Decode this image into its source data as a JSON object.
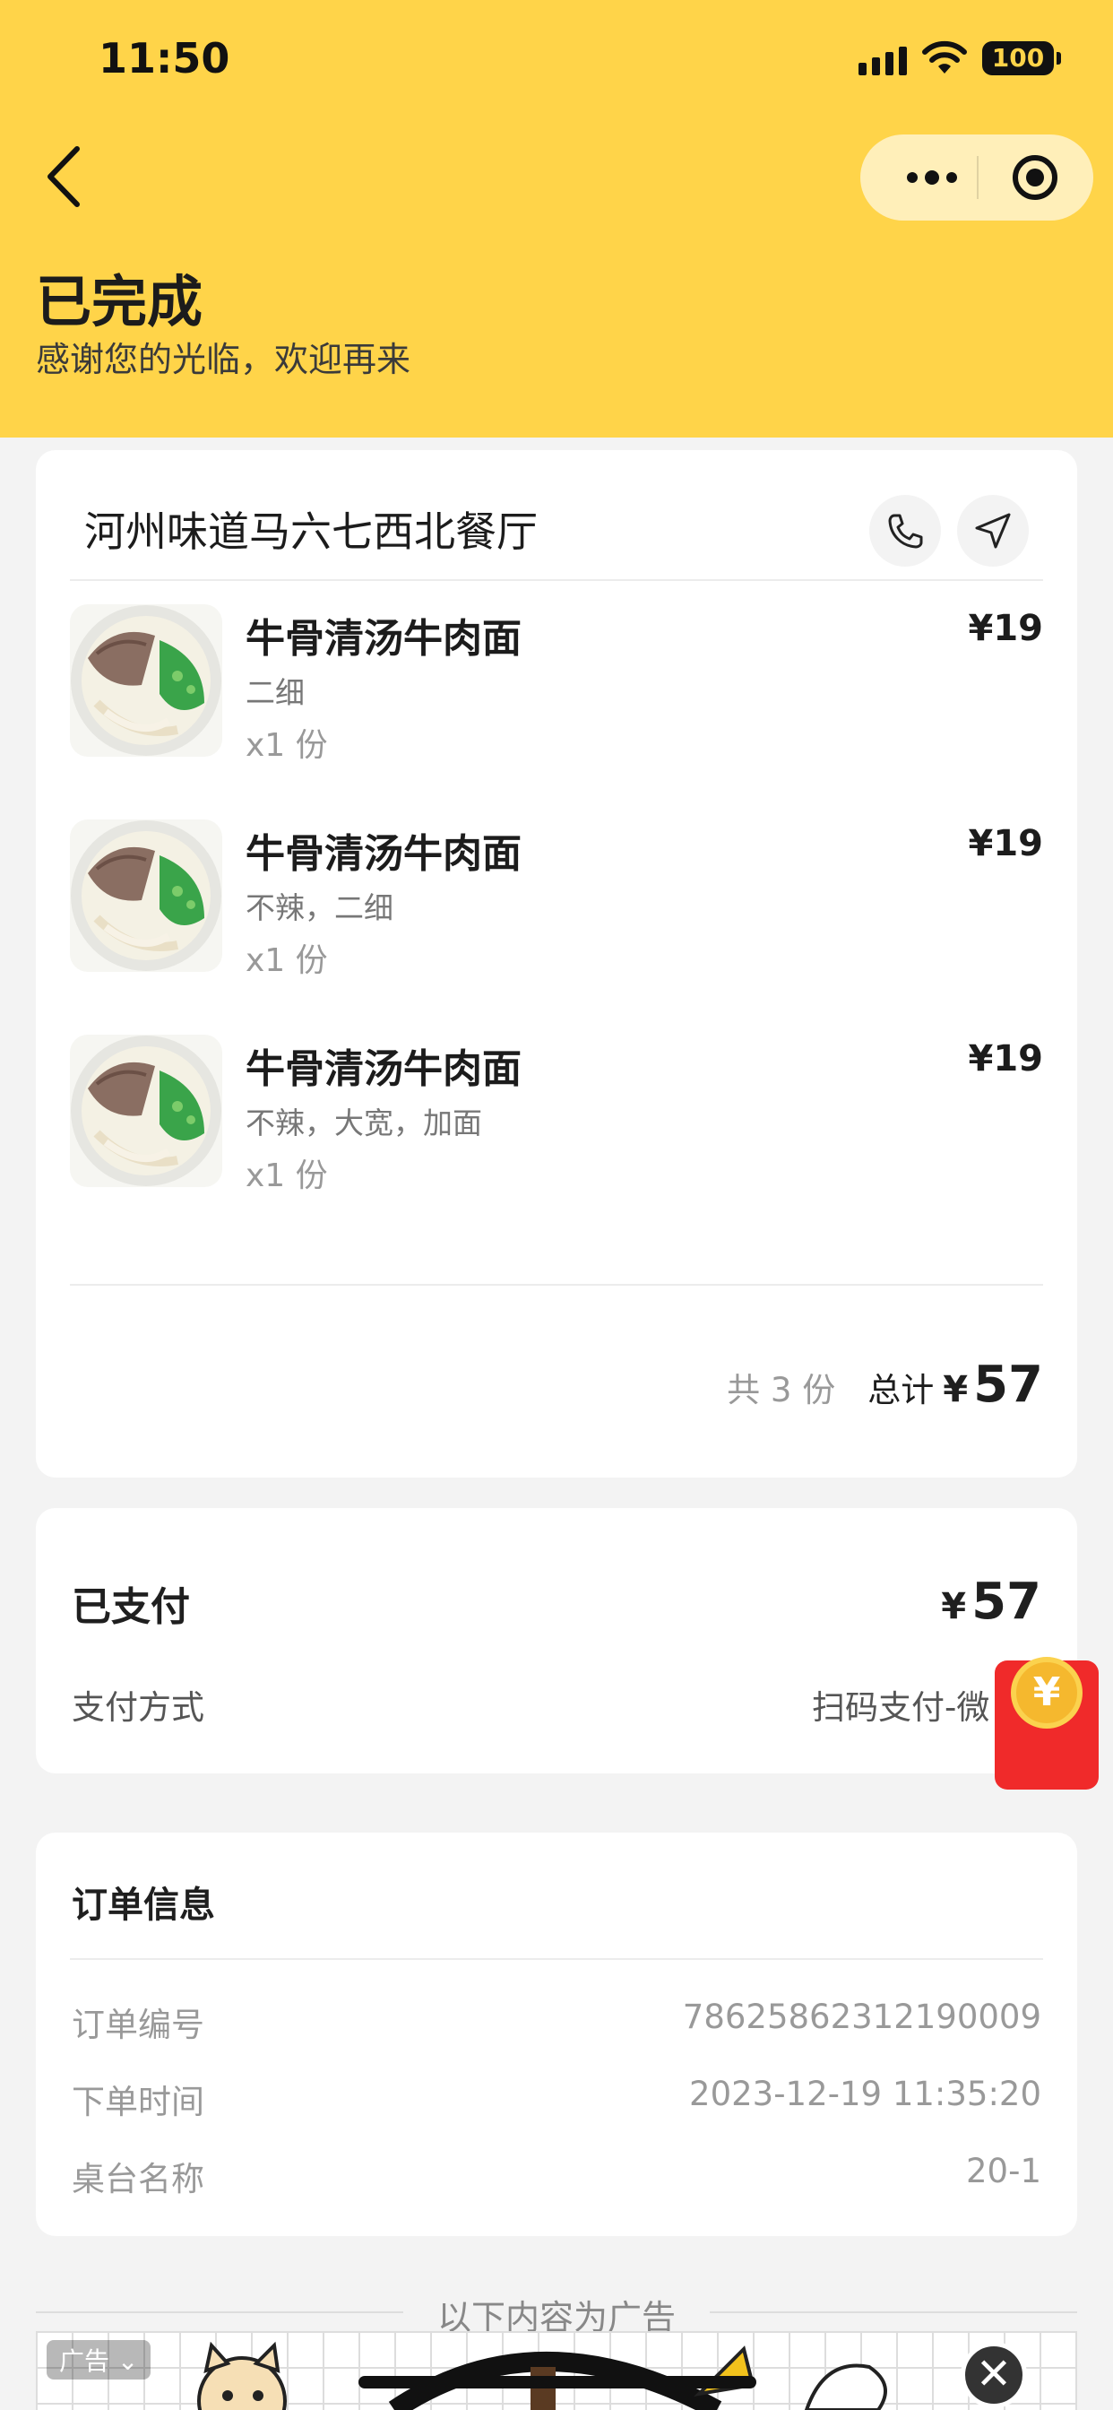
{
  "status_bar": {
    "time": "11:50",
    "battery": "100"
  },
  "header": {
    "title": "已完成",
    "subtitle": "感谢您的光临，欢迎再来"
  },
  "shop": {
    "name": "河州味道马六七西北餐厅",
    "phone_icon": "phone-icon",
    "navigate_icon": "navigation-arrow-icon"
  },
  "items": [
    {
      "name": "牛骨清汤牛肉面",
      "spec": "二细",
      "qty": "x1 份",
      "price": "¥19"
    },
    {
      "name": "牛骨清汤牛肉面",
      "spec": "不辣，二细",
      "qty": "x1 份",
      "price": "¥19"
    },
    {
      "name": "牛骨清汤牛肉面",
      "spec": "不辣，大宽，加面",
      "qty": "x1 份",
      "price": "¥19"
    }
  ],
  "summary": {
    "count": "共 3 份",
    "total_label": "总计",
    "currency": "¥",
    "total": "57"
  },
  "payment": {
    "status": "已支付",
    "currency": "¥",
    "amount": "57",
    "method_label": "支付方式",
    "method_value": "扫码支付-微"
  },
  "order_info": {
    "title": "订单信息",
    "rows": [
      {
        "label": "订单编号",
        "value": "78625862312190009"
      },
      {
        "label": "下单时间",
        "value": "2023-12-19 11:35:20"
      },
      {
        "label": "桌台名称",
        "value": "20-1"
      }
    ]
  },
  "ad": {
    "divider_text": "以下内容为广告",
    "tag": "广告 ⌄",
    "close": "✕"
  },
  "red_packet": {
    "symbol": "¥"
  },
  "colors": {
    "header_bg": "#FFD449",
    "page_bg": "#F3F3F3",
    "red_packet": "#F02A2A"
  }
}
